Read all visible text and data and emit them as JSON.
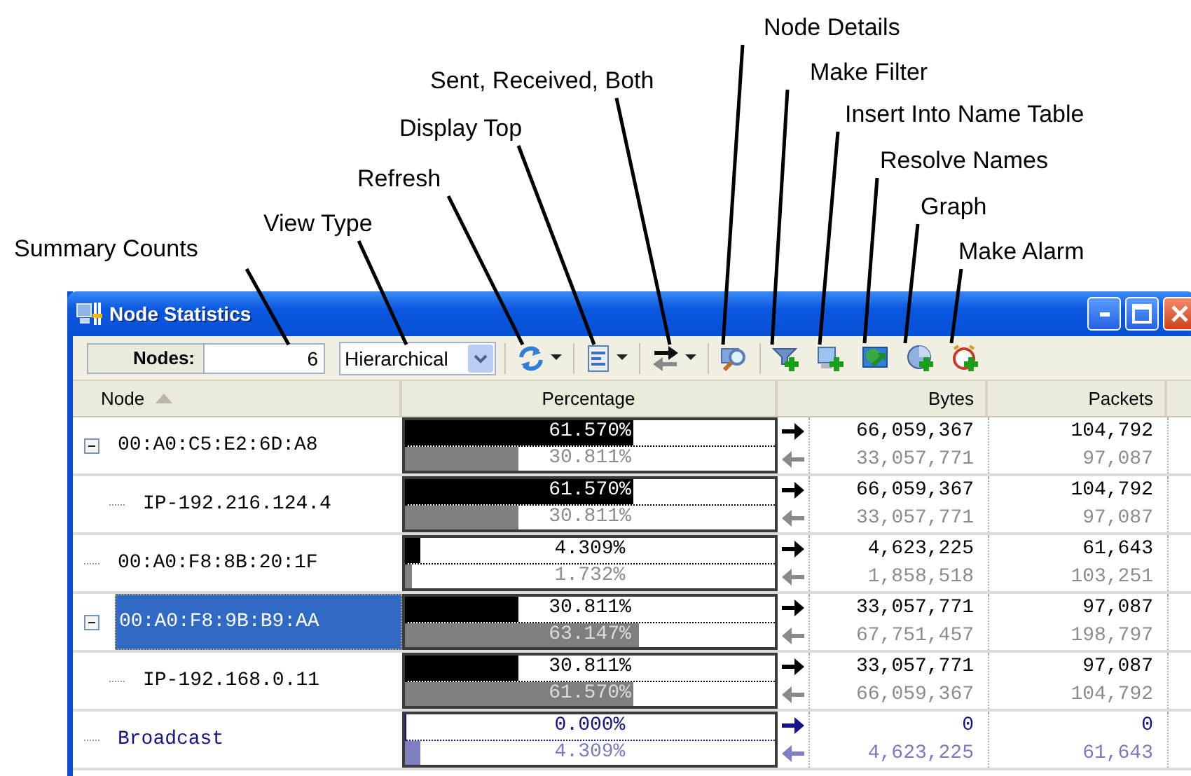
{
  "callouts": [
    {
      "label": "Node Details"
    },
    {
      "label": "Make Filter"
    },
    {
      "label": "Sent, Received, Both"
    },
    {
      "label": "Insert Into Name Table"
    },
    {
      "label": "Display Top"
    },
    {
      "label": "Resolve Names"
    },
    {
      "label": "Refresh"
    },
    {
      "label": "Graph"
    },
    {
      "label": "View Type"
    },
    {
      "label": "Summary Counts"
    },
    {
      "label": "Make Alarm"
    }
  ],
  "window": {
    "title": "Node Statistics"
  },
  "toolbar": {
    "nodes_label": "Nodes:",
    "nodes_value": "6",
    "view_type": "Hierarchical",
    "tools": [
      {
        "kind": "refresh",
        "dropdown": true
      },
      {
        "kind": "display-top",
        "dropdown": true
      },
      {
        "kind": "direction",
        "dropdown": true
      },
      {
        "kind": "details",
        "dropdown": false
      },
      {
        "kind": "filter",
        "dropdown": false
      },
      {
        "kind": "name-table",
        "dropdown": false
      },
      {
        "kind": "resolve",
        "dropdown": false
      },
      {
        "kind": "graph",
        "dropdown": false
      },
      {
        "kind": "alarm",
        "dropdown": false
      }
    ]
  },
  "columns": [
    {
      "label": "Node",
      "sorted": true
    },
    {
      "label": "Percentage",
      "sorted": false
    },
    {
      "label": "Bytes",
      "sorted": false
    },
    {
      "label": "Packets",
      "sorted": false
    }
  ],
  "rows": [
    {
      "name": "00:A0:C5:E2:6D:A8",
      "kind": "node",
      "expanded": true,
      "selected": false,
      "sent": {
        "percent": "61.570%",
        "level": 0.6157,
        "bytes": "66,059,367",
        "packets": "104,792"
      },
      "received": {
        "percent": "30.811%",
        "level": 0.30811,
        "bytes": "33,057,771",
        "packets": "97,087"
      },
      "children": [
        {
          "name": "IP-192.216.124.4",
          "kind": "node",
          "selected": false,
          "sent": {
            "percent": "61.570%",
            "level": 0.6157,
            "bytes": "66,059,367",
            "packets": "104,792"
          },
          "received": {
            "percent": "30.811%",
            "level": 0.30811,
            "bytes": "33,057,771",
            "packets": "97,087"
          }
        }
      ]
    },
    {
      "name": "00:A0:F8:8B:20:1F",
      "kind": "node",
      "selected": false,
      "sent": {
        "percent": "4.309%",
        "level": 0.04309,
        "bytes": "4,623,225",
        "packets": "61,643"
      },
      "received": {
        "percent": "1.732%",
        "level": 0.01732,
        "bytes": "1,858,518",
        "packets": "103,251"
      }
    },
    {
      "name": "00:A0:F8:9B:B9:AA",
      "kind": "node",
      "expanded": true,
      "selected": true,
      "sent": {
        "percent": "30.811%",
        "level": 0.30811,
        "bytes": "33,057,771",
        "packets": "97,087"
      },
      "received": {
        "percent": "63.147%",
        "level": 0.63147,
        "bytes": "67,751,457",
        "packets": "198,797"
      },
      "children": [
        {
          "name": "IP-192.168.0.11",
          "kind": "node",
          "selected": false,
          "sent": {
            "percent": "30.811%",
            "level": 0.30811,
            "bytes": "33,057,771",
            "packets": "97,087"
          },
          "received": {
            "percent": "61.570%",
            "level": 0.6157,
            "bytes": "66,059,367",
            "packets": "104,792"
          }
        }
      ]
    },
    {
      "name": "Broadcast",
      "kind": "broadcast",
      "selected": false,
      "sent": {
        "percent": "0.000%",
        "level": 0,
        "bytes": "0",
        "packets": "0"
      },
      "received": {
        "percent": "4.309%",
        "level": 0.04309,
        "bytes": "4,623,225",
        "packets": "61,643"
      }
    }
  ]
}
